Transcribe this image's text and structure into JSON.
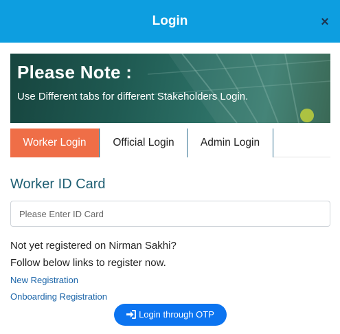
{
  "header": {
    "title": "Login",
    "close_label": "×"
  },
  "banner": {
    "title": "Please Note :",
    "subtitle": "Use Different tabs for different Stakeholders Login."
  },
  "tabs": [
    {
      "label": "Worker Login",
      "active": true
    },
    {
      "label": "Official Login",
      "active": false
    },
    {
      "label": "Admin Login",
      "active": false
    }
  ],
  "form": {
    "field_label": "Worker ID Card",
    "id_input": {
      "value": "",
      "placeholder": "Please Enter ID Card"
    }
  },
  "info": {
    "line1": "Not yet registered on Nirman Sakhi?",
    "line2": "Follow below links to register now."
  },
  "links": {
    "new_registration": "New Registration",
    "onboarding_registration": "Onboarding Registration"
  },
  "otp_button": {
    "label": "Login through OTP",
    "icon": "sign-in-icon"
  },
  "colors": {
    "header": "#0d9ee0",
    "active_tab": "#ef6e47",
    "field_label": "#1f5f73",
    "link": "#1a64a8",
    "otp_button": "#0c74f0"
  }
}
